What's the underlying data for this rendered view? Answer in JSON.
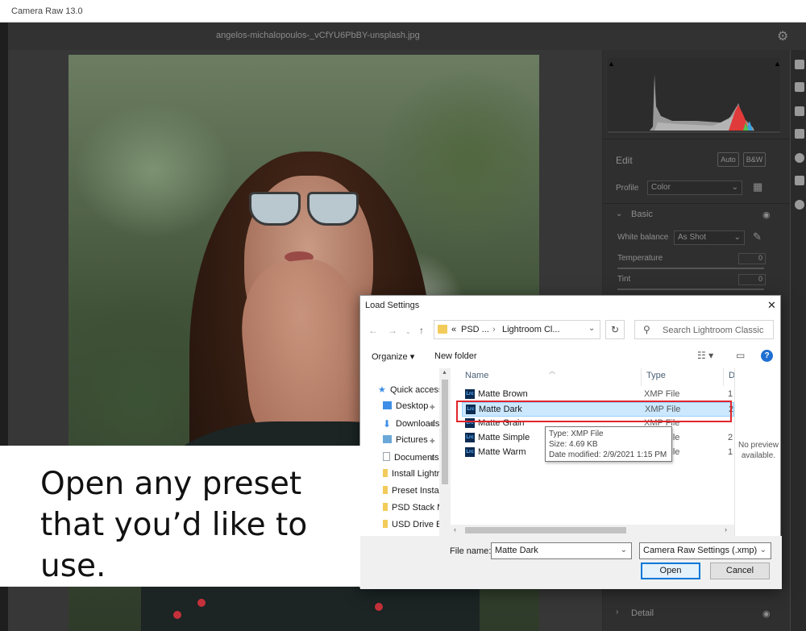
{
  "app": {
    "title": "Camera Raw 13.0",
    "filename": "angelos-michalopoulos-_vCfYU6PbBY-unsplash.jpg"
  },
  "panel": {
    "edit_label": "Edit",
    "auto_label": "Auto",
    "bw_label": "B&W",
    "profile_label": "Profile",
    "profile_value": "Color",
    "basic_label": "Basic",
    "white_balance_label": "White balance",
    "white_balance_value": "As Shot",
    "temperature_label": "Temperature",
    "temperature_value": "0",
    "tint_label": "Tint",
    "tint_value": "0",
    "detail_label": "Detail"
  },
  "dialog": {
    "title": "Load Settings",
    "address": {
      "prefix": "«",
      "crumb1": "PSD ...",
      "sep": "›",
      "crumb2": "Lightroom Cl..."
    },
    "search_placeholder": "Search Lightroom Classic",
    "toolbar": {
      "organize": "Organize ▾",
      "new_folder": "New folder"
    },
    "nav_items": [
      {
        "label": "Quick access",
        "icon": "star-icon",
        "color": "#3c8ee6"
      },
      {
        "label": "Desktop",
        "icon": "desktop-icon",
        "color": "#3c8ee6"
      },
      {
        "label": "Downloads",
        "icon": "download-arrow-icon",
        "color": "#3c8ee6"
      },
      {
        "label": "Pictures",
        "icon": "pictures-icon",
        "color": "#6aa8d8"
      },
      {
        "label": "Documents",
        "icon": "document-icon",
        "color": "#cfd6dc"
      },
      {
        "label": "Install Lightroom",
        "icon": "folder-icon",
        "color": "#f2cb5a"
      },
      {
        "label": "Preset Install",
        "icon": "folder-icon",
        "color": "#f2cb5a"
      },
      {
        "label": "PSD Stack Mini",
        "icon": "folder-icon",
        "color": "#f2cb5a"
      },
      {
        "label": "USD Drive Backup",
        "icon": "folder-icon",
        "color": "#f2cb5a"
      }
    ],
    "columns": {
      "name": "Name",
      "type": "Type",
      "date": "D"
    },
    "files": [
      {
        "name": "Matte Brown",
        "type": "XMP File",
        "date": "1"
      },
      {
        "name": "Matte Dark",
        "type": "XMP File",
        "date": "2"
      },
      {
        "name": "Matte Grain",
        "type": "XMP File",
        "date": ""
      },
      {
        "name": "Matte Simple",
        "type": "XMP File",
        "date": "2"
      },
      {
        "name": "Matte Warm",
        "type": "XMP File",
        "date": "1"
      }
    ],
    "tooltip": {
      "line1": "Type: XMP File",
      "line2": "Size: 4.69 KB",
      "line3": "Date modified: 2/9/2021 1:15 PM"
    },
    "preview": {
      "line1": "No preview",
      "line2": "available."
    },
    "file_name_label": "File name:",
    "file_name_value": "Matte Dark",
    "file_type_value": "Camera Raw Settings (.xmp)",
    "open_label": "Open",
    "cancel_label": "Cancel"
  },
  "caption": {
    "text": "Open any preset that you’d like to use."
  },
  "colors": {
    "selection": "#cce8ff",
    "highlight_box": "#e1262c",
    "accent": "#0078d7"
  }
}
